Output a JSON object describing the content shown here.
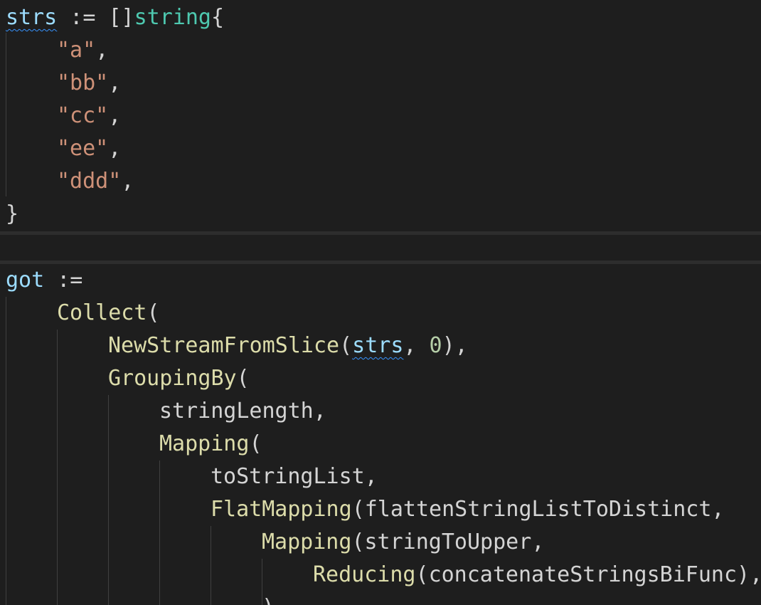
{
  "colors": {
    "background": "#1e1e1e",
    "variable": "#9cdcfe",
    "type": "#4ec9b0",
    "string": "#ce9178",
    "function": "#dcdcaa",
    "number": "#b5cea8",
    "punctuation": "#d4d4d4",
    "squiggle": "#3794ff"
  },
  "block1": {
    "decl_var": "strs",
    "decl_op": " := ",
    "decl_brackets": "[]",
    "decl_type": "string",
    "decl_open": "{",
    "items": [
      "\"a\"",
      "\"bb\"",
      "\"cc\"",
      "\"ee\"",
      "\"ddd\""
    ],
    "comma": ",",
    "close": "}"
  },
  "block2": {
    "decl_var": "got",
    "decl_op": " :=",
    "collect_fn": "Collect",
    "paren_open": "(",
    "paren_close": ")",
    "comma": ",",
    "comma_space": ", ",
    "stream_fn": "NewStreamFromSlice",
    "stream_arg_var": "strs",
    "stream_arg_num": "0",
    "stream_close": "),",
    "grouping_fn": "GroupingBy",
    "string_length": "stringLength",
    "mapping_fn": "Mapping",
    "to_string_list": "toStringList",
    "flatmapping_fn": "FlatMapping",
    "flatten_arg": "flattenStringListToDistinct",
    "mapping2_fn": "Mapping",
    "string_to_upper": "stringToUpper",
    "reducing_fn": "Reducing",
    "concat_arg": "concatenateStringsBiFunc",
    "reducing_close": "),",
    "partial_close": ")"
  }
}
